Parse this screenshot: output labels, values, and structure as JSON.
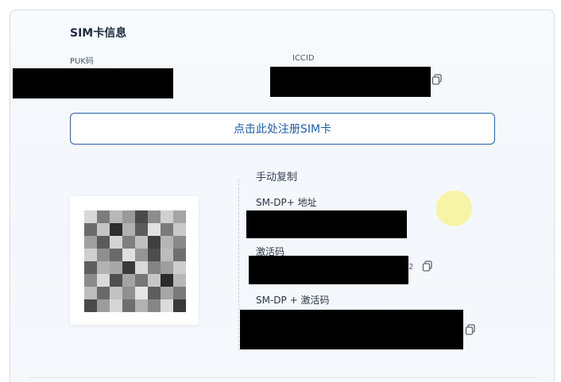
{
  "sim_info": {
    "title": "SIM卡信息",
    "puk_label": "PUK码",
    "iccid_label": "ICCID",
    "copy_icon": "copy-icon"
  },
  "register": {
    "button_label": "点击此处注册SIM卡"
  },
  "manual_copy": {
    "title": "手动复制",
    "smdp_label": "SM-DP+ 地址",
    "activation_label": "激活码",
    "activation_suffix": "2",
    "combined_label": "SM-DP + 激活码"
  },
  "colors": {
    "accent": "#1f5ea8",
    "redaction": "#000000",
    "highlight": "#f6f39c"
  }
}
